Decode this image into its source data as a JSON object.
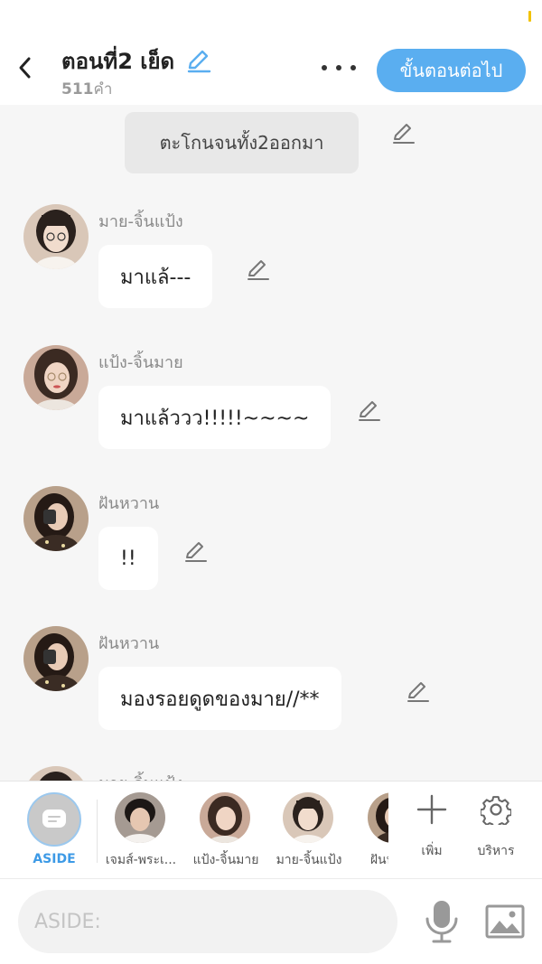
{
  "header": {
    "title": "ตอนที่2 เย็ด",
    "word_count_number": "511",
    "word_count_unit": "คำ",
    "next_step_label": "ขั้นตอนต่อไป"
  },
  "chat": {
    "narration": "ตะโกนจนทั้ง2ออกมา",
    "messages": [
      {
        "sender": "มาย-จิ้นแป้ง",
        "text": "มาแล้---"
      },
      {
        "sender": "แป้ง-จิ้นมาย",
        "text": "มาแล้ววว!!!!!~~~~"
      },
      {
        "sender": "ฝันหวาน",
        "text": "!!"
      },
      {
        "sender": "ฝันหวาน",
        "text": "มองรอยดูดของมาย//**"
      },
      {
        "sender": "มาย-จิ้นแป้ง",
        "text": ""
      }
    ]
  },
  "toolbar": {
    "aside_label": "ASIDE",
    "characters": [
      {
        "name": "เจมส์-พระเ..."
      },
      {
        "name": "แป้ง-จิ้นมาย"
      },
      {
        "name": "มาย-จิ้นแป้ง"
      },
      {
        "name": "ฝันหวาน"
      }
    ],
    "add_label": "เพิ่ม",
    "manage_label": "บริหาร"
  },
  "input": {
    "placeholder": "ASIDE:"
  },
  "colors": {
    "accent": "#5aaef0",
    "aside_blue": "#3d9ae6",
    "status_indicator": "#f2c200"
  }
}
